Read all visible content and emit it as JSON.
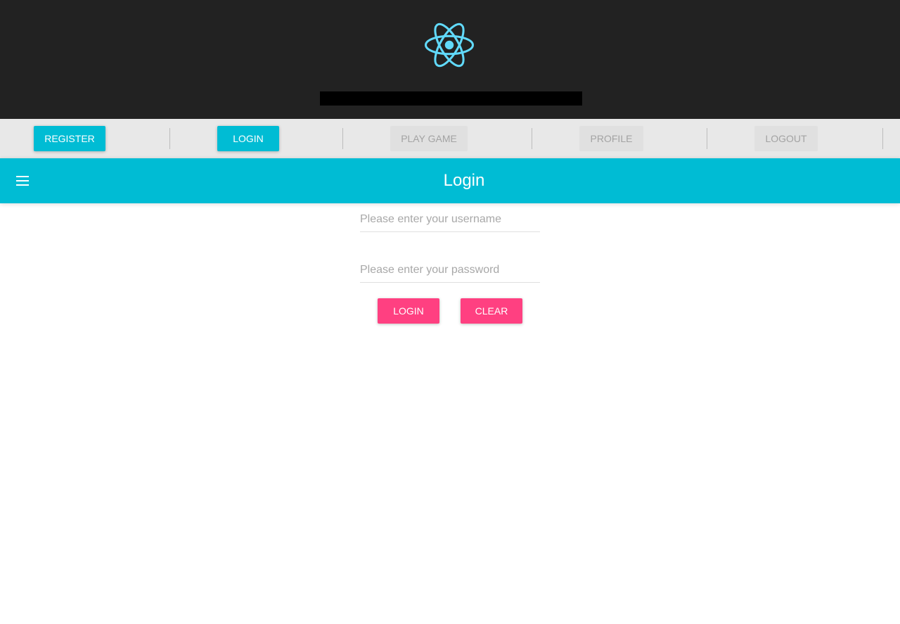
{
  "header": {
    "logo": "react-atom-icon",
    "logo_color": "#61dafb"
  },
  "nav": {
    "items": [
      {
        "label": "REGISTER",
        "state": "active"
      },
      {
        "label": "LOGIN",
        "state": "active"
      },
      {
        "label": "PLAY GAME",
        "state": "disabled"
      },
      {
        "label": "PROFILE",
        "state": "disabled"
      },
      {
        "label": "LOGOUT",
        "state": "disabled"
      }
    ]
  },
  "appbar": {
    "title": "Login",
    "menu_icon": "hamburger-menu-icon",
    "color": "#00bcd4"
  },
  "form": {
    "username_placeholder": "Please enter your username",
    "username_value": "",
    "password_placeholder": "Please enter your password",
    "password_value": "",
    "login_label": "LOGIN",
    "clear_label": "CLEAR",
    "button_color": "#ff4081"
  }
}
